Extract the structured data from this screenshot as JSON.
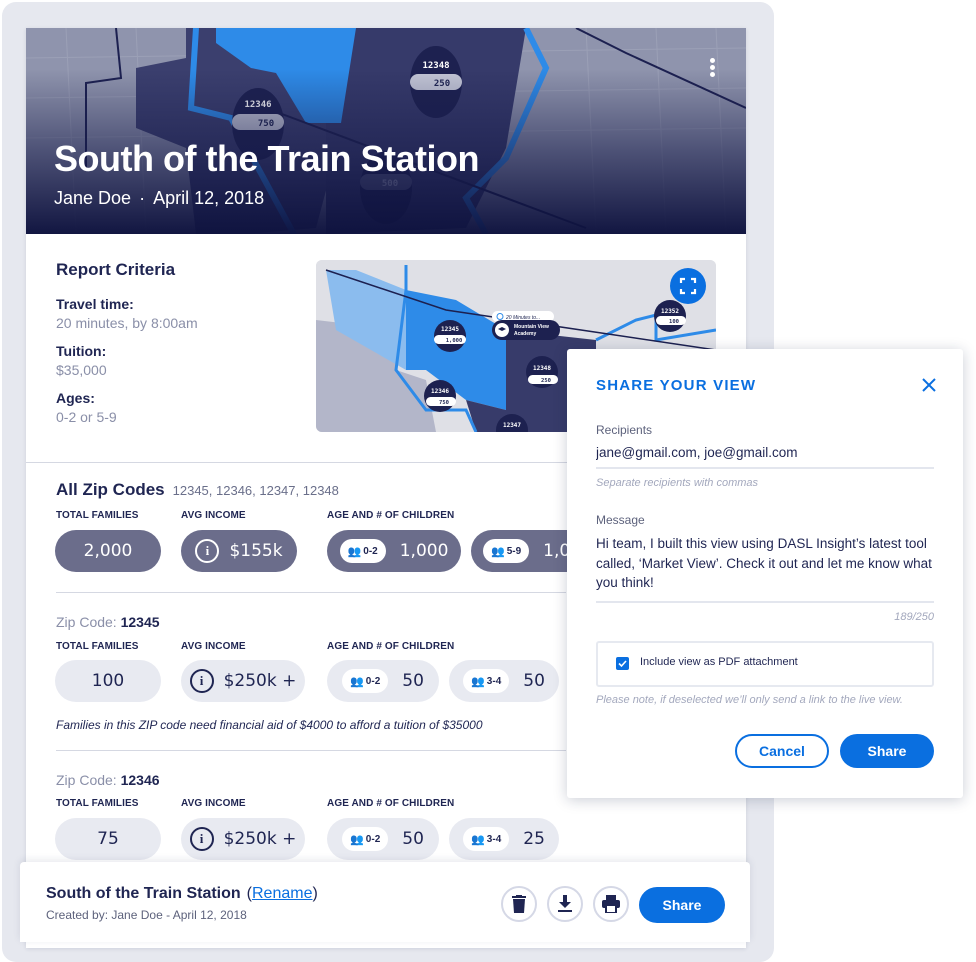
{
  "hero": {
    "title": "South of the Train Station",
    "author": "Jane Doe",
    "separator": "·",
    "date": "April 12, 2018",
    "markers": [
      {
        "zip": "12348",
        "count": "250"
      },
      {
        "zip": "12346",
        "count": "750"
      },
      {
        "zip": "12347",
        "count": "500"
      }
    ]
  },
  "criteria": {
    "title": "Report Criteria",
    "items": [
      {
        "label": "Travel time:",
        "value": "20 minutes, by 8:00am"
      },
      {
        "label": "Tuition:",
        "value": "$35,000"
      },
      {
        "label": "Ages:",
        "value": "0-2 or 5-9"
      }
    ]
  },
  "mini_map": {
    "travel_label": "20 Minutes to...",
    "school_line1": "Mountain View",
    "school_line2": "Academy",
    "markers": [
      {
        "zip": "12345",
        "count": "1,000"
      },
      {
        "zip": "12346",
        "count": "750"
      },
      {
        "zip": "12348",
        "count": "250"
      },
      {
        "zip": "12347",
        "count": ""
      },
      {
        "zip": "12352",
        "count": "100"
      }
    ]
  },
  "labels": {
    "total_families": "TOTAL FAMILIES",
    "avg_income": "AVG INCOME",
    "age_children": "AGE AND # OF CHILDREN",
    "zip_prefix": "Zip Code:"
  },
  "all_zips": {
    "title": "All Zip Codes",
    "zips": "12345, 12346, 12347, 12348",
    "total_families": "2,000",
    "avg_income": "$155k",
    "ages": [
      {
        "range": "0-2",
        "count": "1,000"
      },
      {
        "range": "5-9",
        "count": "1,0"
      }
    ]
  },
  "zip_sections": [
    {
      "zip": "12345",
      "total_families": "100",
      "avg_income": "$250k +",
      "ages": [
        {
          "range": "0-2",
          "count": "50"
        },
        {
          "range": "3-4",
          "count": "50"
        }
      ],
      "note": "Families in this ZIP code need financial aid of $4000 to afford a tuition of $35000"
    },
    {
      "zip": "12346",
      "total_families": "75",
      "avg_income": "$250k +",
      "ages": [
        {
          "range": "0-2",
          "count": "50"
        },
        {
          "range": "3-4",
          "count": "25"
        }
      ]
    }
  ],
  "bottom_bar": {
    "title": "South of the Train Station",
    "rename_open": "(",
    "rename_label": "Rename",
    "rename_close": ")",
    "created": "Created by: Jane Doe - April 12, 2018",
    "share_label": "Share"
  },
  "modal": {
    "title": "SHARE YOUR VIEW",
    "recipients_label": "Recipients",
    "recipients_value": "jane@gmail.com, joe@gmail.com",
    "recipients_hint": "Separate recipients with commas",
    "message_label": "Message",
    "message_value": "Hi team, I built this view using DASL Insight’s latest tool called, ‘Market View’. Check it out and let me know what you think!",
    "counter": "189/250",
    "pdf_label": "Include view as PDF attachment",
    "pdf_checked": true,
    "pdf_note": "Please note, if deselected we’ll only send a link to the live view.",
    "cancel_label": "Cancel",
    "share_label": "Share"
  },
  "colors": {
    "accent": "#0a6fe0",
    "navy": "#1f2552",
    "pill_dark": "#6b6d8b",
    "pill_light": "#e8eaf1"
  }
}
